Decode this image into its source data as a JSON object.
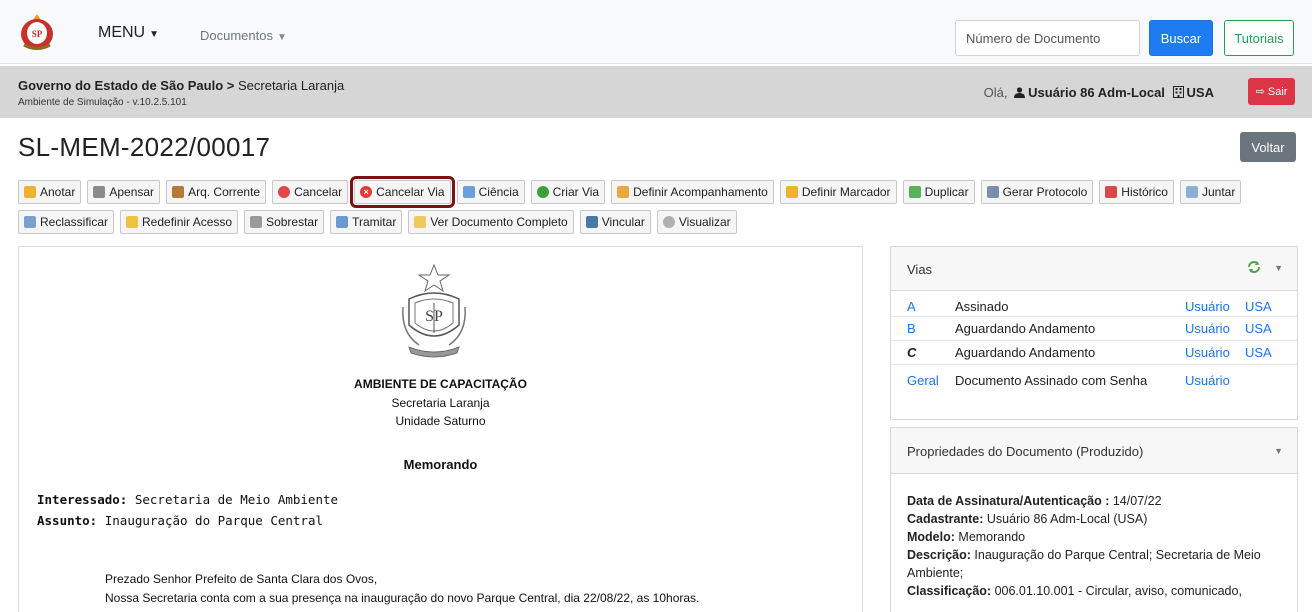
{
  "navbar": {
    "menu_label": "MENU",
    "documents_label": "Documentos",
    "search_placeholder": "Número de Documento",
    "search_button": "Buscar",
    "tutorials_button": "Tutoriais"
  },
  "header": {
    "org": "Governo do Estado de São Paulo",
    "separator": " > ",
    "department": "Secretaria Laranja",
    "environment": "Ambiente de Simulação - v.10.2.5.101",
    "greeting": "Olá,",
    "user": "Usuário 86 Adm-Local",
    "unit": "USA",
    "logout_button": "Sair"
  },
  "page": {
    "title": "SL-MEM-2022/00017",
    "back_button": "Voltar"
  },
  "actions": {
    "row1": [
      "Anotar",
      "Apensar",
      "Arq. Corrente",
      "Cancelar",
      "Cancelar Via",
      "Ciência",
      "Criar Via",
      "Definir Acompanhamento",
      "Definir Marcador",
      "Duplicar",
      "Gerar Protocolo",
      "Histórico",
      "Juntar"
    ],
    "row2": [
      "Reclassificar",
      "Redefinir Acesso",
      "Sobrestar",
      "Tramitar",
      "Ver Documento Completo",
      "Vincular",
      "Visualizar"
    ]
  },
  "document": {
    "heading": "AMBIENTE DE CAPACITAÇÃO",
    "secretariat": "Secretaria Laranja",
    "unit": "Unidade Saturno",
    "type": "Memorando",
    "interested_label": "Interessado:",
    "interested_value": "Secretaria de Meio Ambiente",
    "subject_label": "Assunto:",
    "subject_value": "Inauguração do Parque Central",
    "salutation": "Prezado Senhor Prefeito de Santa Clara dos Ovos,",
    "body": "Nossa Secretaria conta com a sua presença na inauguração do novo Parque Central, dia 22/08/22, as 10horas."
  },
  "vias": {
    "title": "Vias",
    "rows": [
      {
        "letter": "A",
        "status": "Assinado",
        "user": "Usuário",
        "org": "USA"
      },
      {
        "letter": "B",
        "status": "Aguardando Andamento",
        "user": "Usuário",
        "org": "USA"
      },
      {
        "letter": "C",
        "status": "Aguardando Andamento",
        "user": "Usuário",
        "org": "USA"
      },
      {
        "letter": "Geral",
        "status": "Documento Assinado com Senha",
        "user": "Usuário",
        "org": ""
      }
    ]
  },
  "properties": {
    "title": "Propriedades do Documento (Produzido)",
    "signature_label": "Data de Assinatura/Autenticação :",
    "signature_value": "14/07/22",
    "registrant_label": "Cadastrante:",
    "registrant_value": "Usuário 86 Adm-Local (USA)",
    "model_label": "Modelo:",
    "model_value": "Memorando",
    "description_label": "Descrição:",
    "description_value": "Inauguração do Parque Central; Secretaria de Meio Ambiente;",
    "classification_label": "Classificação:",
    "classification_value": "006.01.10.001 - Circular, aviso, comunicado,"
  },
  "colors": {
    "primary": "#1f7bf2",
    "success": "#2a9d55",
    "danger": "#dc3545",
    "highlight": "#7a1212"
  }
}
